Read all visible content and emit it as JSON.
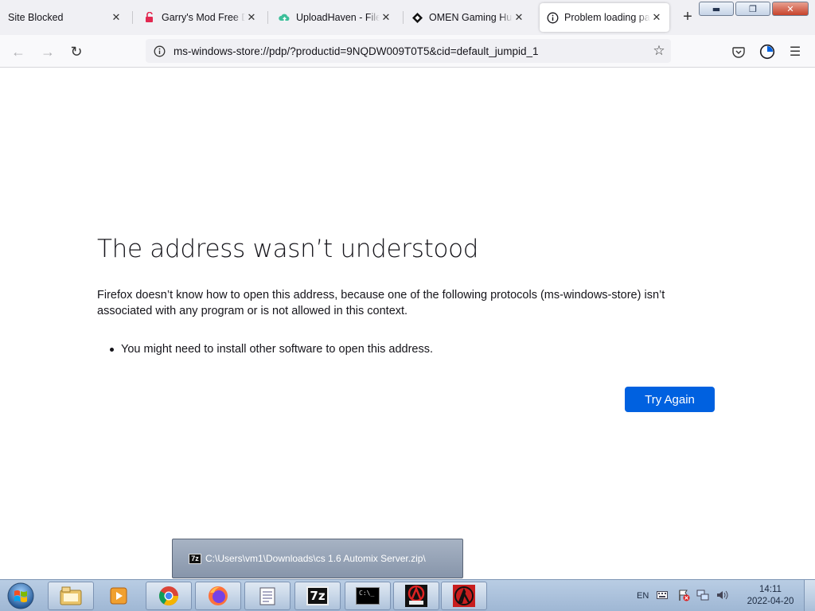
{
  "tabs": [
    {
      "title": "Site Blocked",
      "icon": "none",
      "active": false
    },
    {
      "title": "Garry's Mod Free Download",
      "icon": "lock-open-icon",
      "active": false
    },
    {
      "title": "UploadHaven - File Sharing",
      "icon": "uploadhaven-icon",
      "active": false
    },
    {
      "title": "OMEN Gaming Hub | HP",
      "icon": "omen-diamond-icon",
      "active": false
    },
    {
      "title": "Problem loading page",
      "icon": "info-icon",
      "active": true
    }
  ],
  "tab_close_glyph": "✕",
  "new_tab_glyph": "+",
  "window_controls": {
    "minimize": "▬",
    "maximize": "❐",
    "close": "✕"
  },
  "toolbar": {
    "url": "ms-windows-store://pdp/?productid=9NQDW009T0T5&cid=default_jumpid_1",
    "back_glyph": "←",
    "forward_glyph": "→",
    "reload_glyph": "↻",
    "bookmark_glyph": "☆",
    "menu_glyph": "☰"
  },
  "error": {
    "title": "The address wasn’t understood",
    "description": "Firefox doesn’t know how to open this address, because one of the following protocols (ms-windows-store) isn’t associated with any program or is not allowed in this context.",
    "items": [
      "You might need to install other software to open this address."
    ],
    "button": "Try Again"
  },
  "colors": {
    "primary_button": "#0061e0",
    "tabstrip_bg": "#f0f0f4",
    "taskbar": "#a9bfdc"
  },
  "taskbar_thumbnail": {
    "label": "C:\\Users\\vm1\\Downloads\\cs 1.6 Automix Server.zip\\",
    "icon_text": "7z"
  },
  "taskbar": {
    "apps": [
      "windows-explorer-icon",
      "media-player-icon",
      "chrome-icon",
      "firefox-icon",
      "notepad-icon",
      "7zip-icon",
      "command-prompt-icon",
      "app-icon-red-a",
      "half-life-icon"
    ],
    "seven_zip_label": "7z",
    "cmd_label": "C:\\_",
    "language": "EN",
    "time": "14:11",
    "date": "2022-04-20"
  }
}
